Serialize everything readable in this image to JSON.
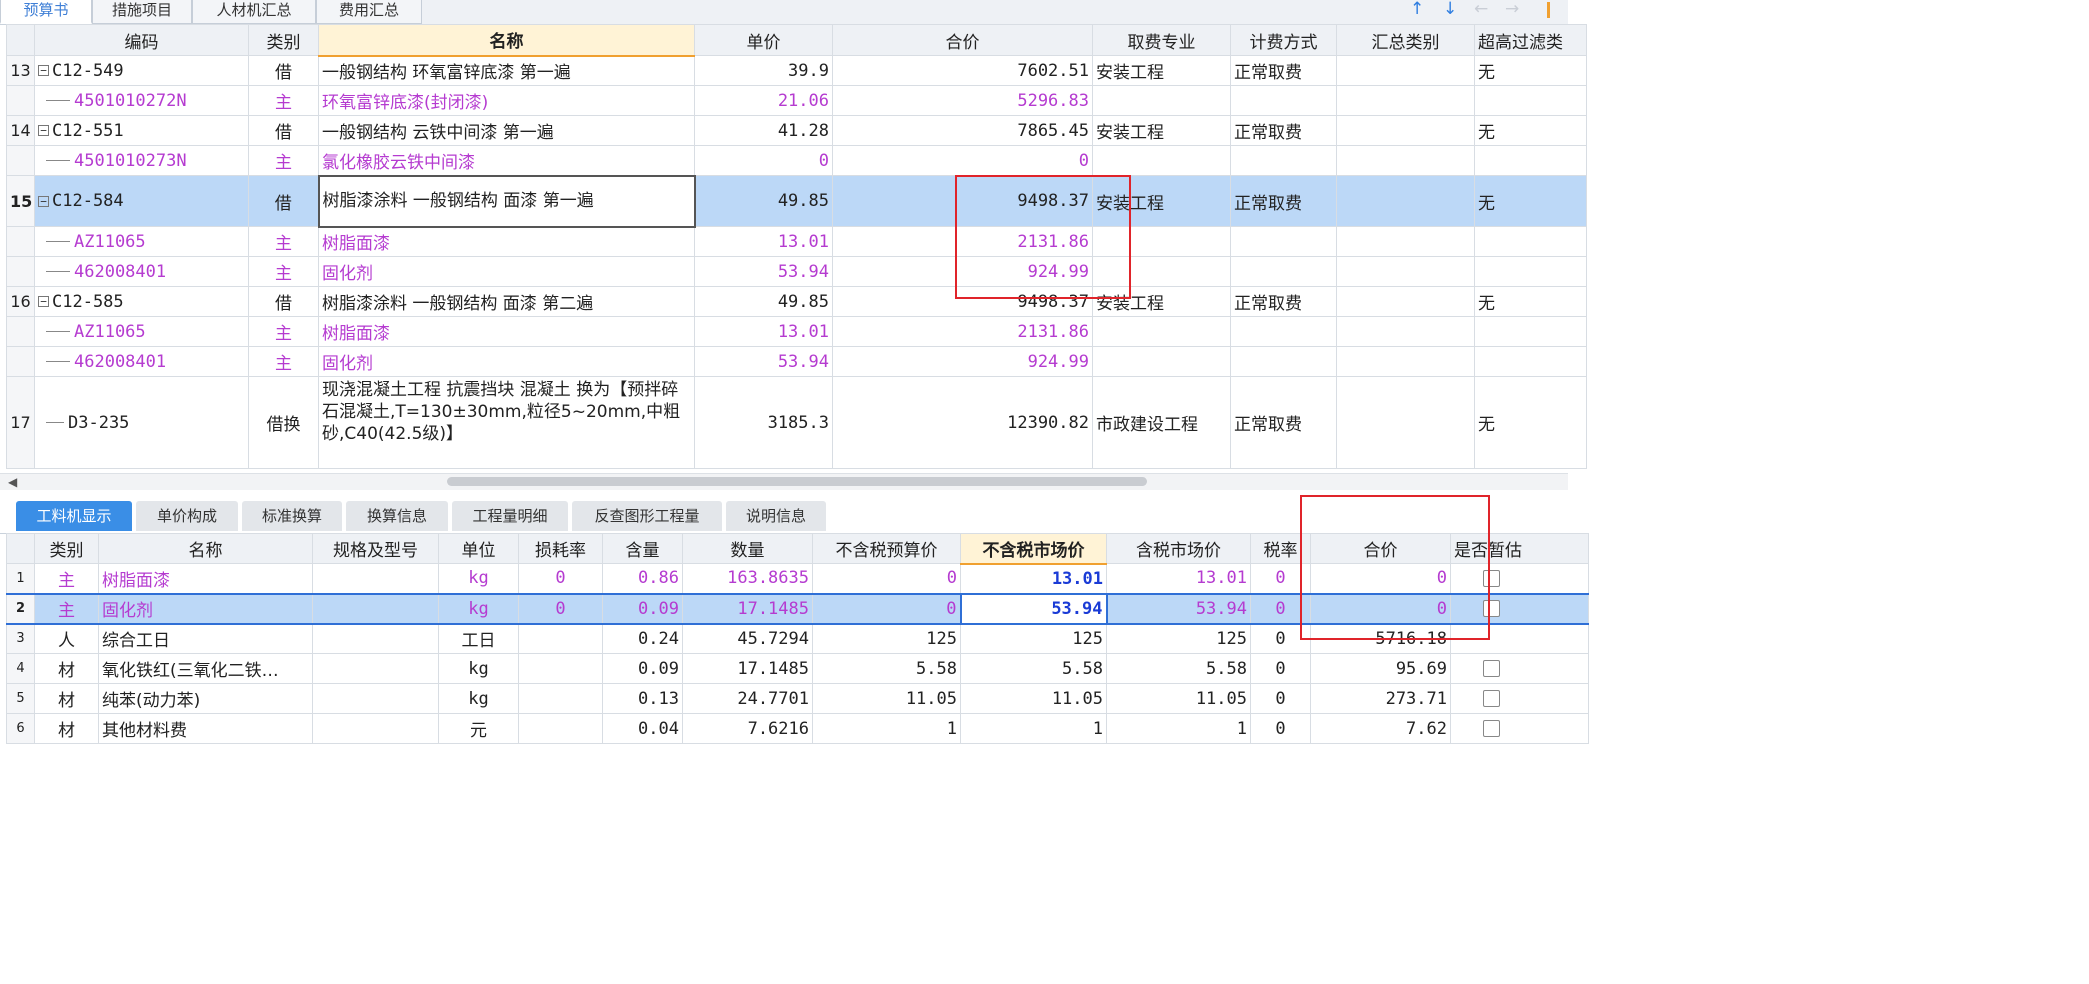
{
  "top_tabs": [
    "预算书",
    "措施项目",
    "人材机汇总",
    "费用汇总"
  ],
  "top_tab_active": 0,
  "toolbar_arrows": [
    "↑",
    "↓",
    "←",
    "→"
  ],
  "main_table": {
    "headers": [
      "编码",
      "类别",
      "名称",
      "单价",
      "合价",
      "取费专业",
      "计费方式",
      "汇总类别",
      "超高过滤类"
    ],
    "rows": [
      {
        "no": "13",
        "code": "C12-549",
        "type": "借",
        "name": "一般钢结构 环氧富锌底漆 第一遍",
        "unit_price": "39.9",
        "total": "7602.51",
        "fee_major": "安装工程",
        "fee_method": "正常取费",
        "summary": "",
        "filter": "无"
      },
      {
        "no": "",
        "code": "4501010272N",
        "type": "主",
        "name": "环氧富锌底漆(封闭漆)",
        "unit_price": "21.06",
        "total": "5296.83",
        "fee_major": "",
        "fee_method": "",
        "summary": "",
        "filter": ""
      },
      {
        "no": "14",
        "code": "C12-551",
        "type": "借",
        "name": "一般钢结构 云铁中间漆 第一遍",
        "unit_price": "41.28",
        "total": "7865.45",
        "fee_major": "安装工程",
        "fee_method": "正常取费",
        "summary": "",
        "filter": "无"
      },
      {
        "no": "",
        "code": "4501010273N",
        "type": "主",
        "name": "氯化橡胶云铁中间漆",
        "unit_price": "0",
        "total": "0",
        "fee_major": "",
        "fee_method": "",
        "summary": "",
        "filter": ""
      },
      {
        "no": "15",
        "code": "C12-584",
        "type": "借",
        "name": "树脂漆涂料 一般钢结构 面漆 第一遍",
        "unit_price": "49.85",
        "total": "9498.37",
        "fee_major": "安装工程",
        "fee_method": "正常取费",
        "summary": "",
        "filter": "无"
      },
      {
        "no": "",
        "code": "AZ11065",
        "type": "主",
        "name": "树脂面漆",
        "unit_price": "13.01",
        "total": "2131.86",
        "fee_major": "",
        "fee_method": "",
        "summary": "",
        "filter": ""
      },
      {
        "no": "",
        "code": "462008401",
        "type": "主",
        "name": "固化剂",
        "unit_price": "53.94",
        "total": "924.99",
        "fee_major": "",
        "fee_method": "",
        "summary": "",
        "filter": ""
      },
      {
        "no": "16",
        "code": "C12-585",
        "type": "借",
        "name": "树脂漆涂料 一般钢结构 面漆 第二遍",
        "unit_price": "49.85",
        "total": "9498.37",
        "fee_major": "安装工程",
        "fee_method": "正常取费",
        "summary": "",
        "filter": "无"
      },
      {
        "no": "",
        "code": "AZ11065",
        "type": "主",
        "name": "树脂面漆",
        "unit_price": "13.01",
        "total": "2131.86",
        "fee_major": "",
        "fee_method": "",
        "summary": "",
        "filter": ""
      },
      {
        "no": "",
        "code": "462008401",
        "type": "主",
        "name": "固化剂",
        "unit_price": "53.94",
        "total": "924.99",
        "fee_major": "",
        "fee_method": "",
        "summary": "",
        "filter": ""
      },
      {
        "no": "17",
        "code": "D3-235",
        "type": "借换",
        "name": "现浇混凝土工程 抗震挡块 混凝土 换为【预拌碎石混凝土,T=130±30mm,粒径5~20mm,中粗砂,C40(42.5级)】",
        "unit_price": "3185.3",
        "total": "12390.82",
        "fee_major": "市政建设工程",
        "fee_method": "正常取费",
        "summary": "",
        "filter": "无"
      }
    ]
  },
  "bottom_tabs": [
    "工料机显示",
    "单价构成",
    "标准换算",
    "换算信息",
    "工程量明细",
    "反查图形工程量",
    "说明信息"
  ],
  "bottom_tab_active": 0,
  "sub_table": {
    "headers": [
      "类别",
      "名称",
      "规格及型号",
      "单位",
      "损耗率",
      "含量",
      "数量",
      "不含税预算价",
      "不含税市场价",
      "含税市场价",
      "税率",
      "合价",
      "是否暂估"
    ],
    "rows": [
      {
        "no": "1",
        "type": "主",
        "name": "树脂面漆",
        "spec": "",
        "unit": "kg",
        "loss": "0",
        "content": "0.86",
        "qty": "163.8635",
        "pre_budget": "0",
        "market": "13.01",
        "market_tax": "13.01",
        "tax_rate": "0",
        "total": "0"
      },
      {
        "no": "2",
        "type": "主",
        "name": "固化剂",
        "spec": "",
        "unit": "kg",
        "loss": "0",
        "content": "0.09",
        "qty": "17.1485",
        "pre_budget": "0",
        "market": "53.94",
        "market_tax": "53.94",
        "tax_rate": "0",
        "total": "0"
      },
      {
        "no": "3",
        "type": "人",
        "name": "综合工日",
        "spec": "",
        "unit": "工日",
        "loss": "",
        "content": "0.24",
        "qty": "45.7294",
        "pre_budget": "125",
        "market": "125",
        "market_tax": "125",
        "tax_rate": "0",
        "total": "5716.18"
      },
      {
        "no": "4",
        "type": "材",
        "name": "氧化铁红(三氧化二铁…",
        "spec": "",
        "unit": "kg",
        "loss": "",
        "content": "0.09",
        "qty": "17.1485",
        "pre_budget": "5.58",
        "market": "5.58",
        "market_tax": "5.58",
        "tax_rate": "0",
        "total": "95.69"
      },
      {
        "no": "5",
        "type": "材",
        "name": "纯苯(动力苯)",
        "spec": "",
        "unit": "kg",
        "loss": "",
        "content": "0.13",
        "qty": "24.7701",
        "pre_budget": "11.05",
        "market": "11.05",
        "market_tax": "11.05",
        "tax_rate": "0",
        "total": "273.71"
      },
      {
        "no": "6",
        "type": "材",
        "name": "其他材料费",
        "spec": "",
        "unit": "元",
        "loss": "",
        "content": "0.04",
        "qty": "7.6216",
        "pre_budget": "1",
        "market": "1",
        "market_tax": "1",
        "tax_rate": "0",
        "total": "7.62"
      }
    ]
  },
  "colors": {
    "accent": "#3a8ee6",
    "selected_row": "#bcd8f7",
    "purple_text": "#b53bd0",
    "annotation_red": "#e0242a"
  }
}
